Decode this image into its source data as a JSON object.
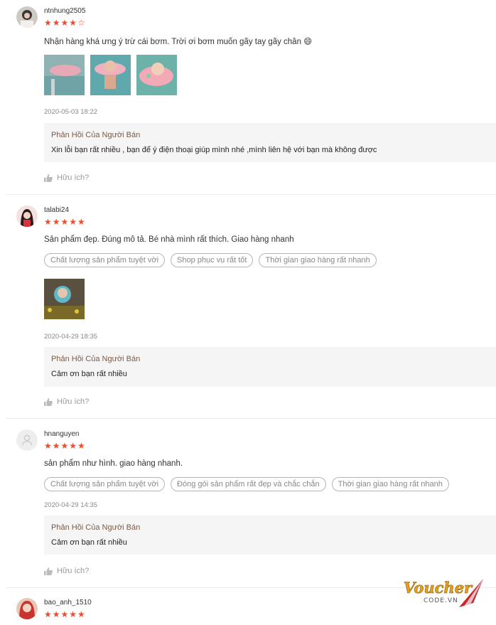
{
  "reviews": [
    {
      "username": "ntnhung2505",
      "rating": 4,
      "content": "Nhận hàng khá ưng ý trừ cái bơm. Trời ơi bơm muốn gãy tay gãy chân 😄",
      "date": "2020-05-03 18:22",
      "reply_title": "Phản Hồi Của Người Bán",
      "reply_text": "Xin lỗi bạn rất nhiều , bạn để ý điện thoại giúp mình nhé ,mình liên hệ với bạn mà không được",
      "helpful": "Hữu ích?"
    },
    {
      "username": "talabi24",
      "rating": 5,
      "content": "Sản phẩm đẹp. Đúng mô tả. Bé nhà mình rất thích. Giao hàng nhanh",
      "tags": [
        "Chất lượng sản phẩm tuyệt vời",
        "Shop phục vụ rất tốt",
        "Thời gian giao hàng rất nhanh"
      ],
      "date": "2020-04-29 18:35",
      "reply_title": "Phản Hồi Của Người Bán",
      "reply_text": "Cảm ơn bạn rất nhiều",
      "helpful": "Hữu ích?"
    },
    {
      "username": "hnanguyen",
      "rating": 5,
      "content": "sản phẩm như hình. giao hàng nhanh.",
      "tags": [
        "Chất lượng sản phẩm tuyệt vời",
        "Đóng gói sản phẩm rất đẹp và chắc chắn",
        "Thời gian giao hàng rất nhanh"
      ],
      "date": "2020-04-29 14:35",
      "reply_title": "Phản Hồi Của Người Bán",
      "reply_text": "Cảm ơn bạn rất nhiều",
      "helpful": "Hữu ích?"
    },
    {
      "username": "bao_anh_1510",
      "rating": 5
    }
  ],
  "watermark": {
    "brand": "Voucher",
    "domain": "CODE.VN"
  },
  "colors": {
    "star": "#ee4d2d",
    "reply_title": "#7a5a46",
    "reply_bg": "#f5f5f5"
  },
  "icons": {
    "helpful": "thumbs-up-icon",
    "generic_avatar": "user-icon"
  }
}
